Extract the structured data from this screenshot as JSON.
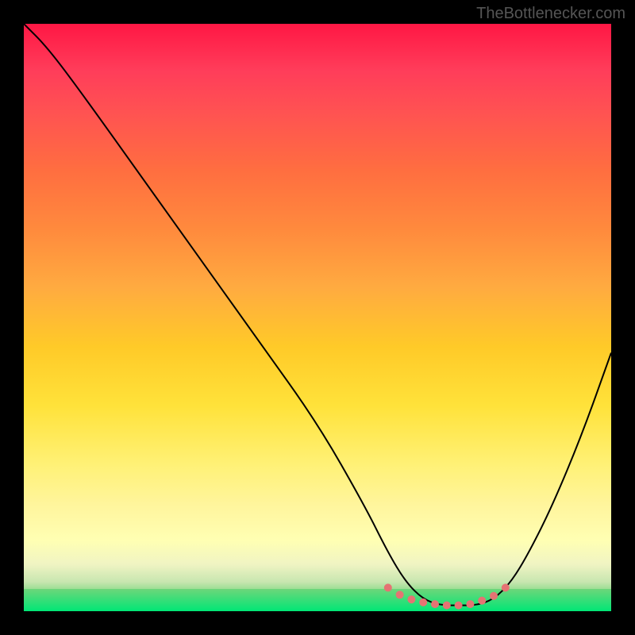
{
  "watermark": "TheBottlenecker.com",
  "chart_data": {
    "type": "line",
    "title": "",
    "xlabel": "",
    "ylabel": "",
    "xlim": [
      0,
      100
    ],
    "ylim": [
      0,
      100
    ],
    "series": [
      {
        "name": "bottleneck-curve",
        "x": [
          0,
          4,
          10,
          20,
          30,
          40,
          50,
          58,
          62,
          65,
          68,
          71,
          74,
          77,
          80,
          83,
          86,
          90,
          95,
          100
        ],
        "values": [
          100,
          96,
          88,
          74,
          60,
          46,
          32,
          18,
          10,
          5,
          2,
          1,
          1,
          1,
          2,
          5,
          10,
          18,
          30,
          44
        ]
      }
    ],
    "markers": {
      "name": "optimal-range-dots",
      "x": [
        62,
        64,
        66,
        68,
        70,
        72,
        74,
        76,
        78,
        80,
        82
      ],
      "values": [
        4.0,
        2.8,
        2.0,
        1.5,
        1.2,
        1.0,
        1.0,
        1.2,
        1.8,
        2.6,
        4.0
      ]
    },
    "gradient_stops": [
      {
        "pos": 0,
        "color": "#ff1744"
      },
      {
        "pos": 50,
        "color": "#ffca28"
      },
      {
        "pos": 90,
        "color": "#fff59d"
      },
      {
        "pos": 100,
        "color": "#00e676"
      }
    ]
  }
}
